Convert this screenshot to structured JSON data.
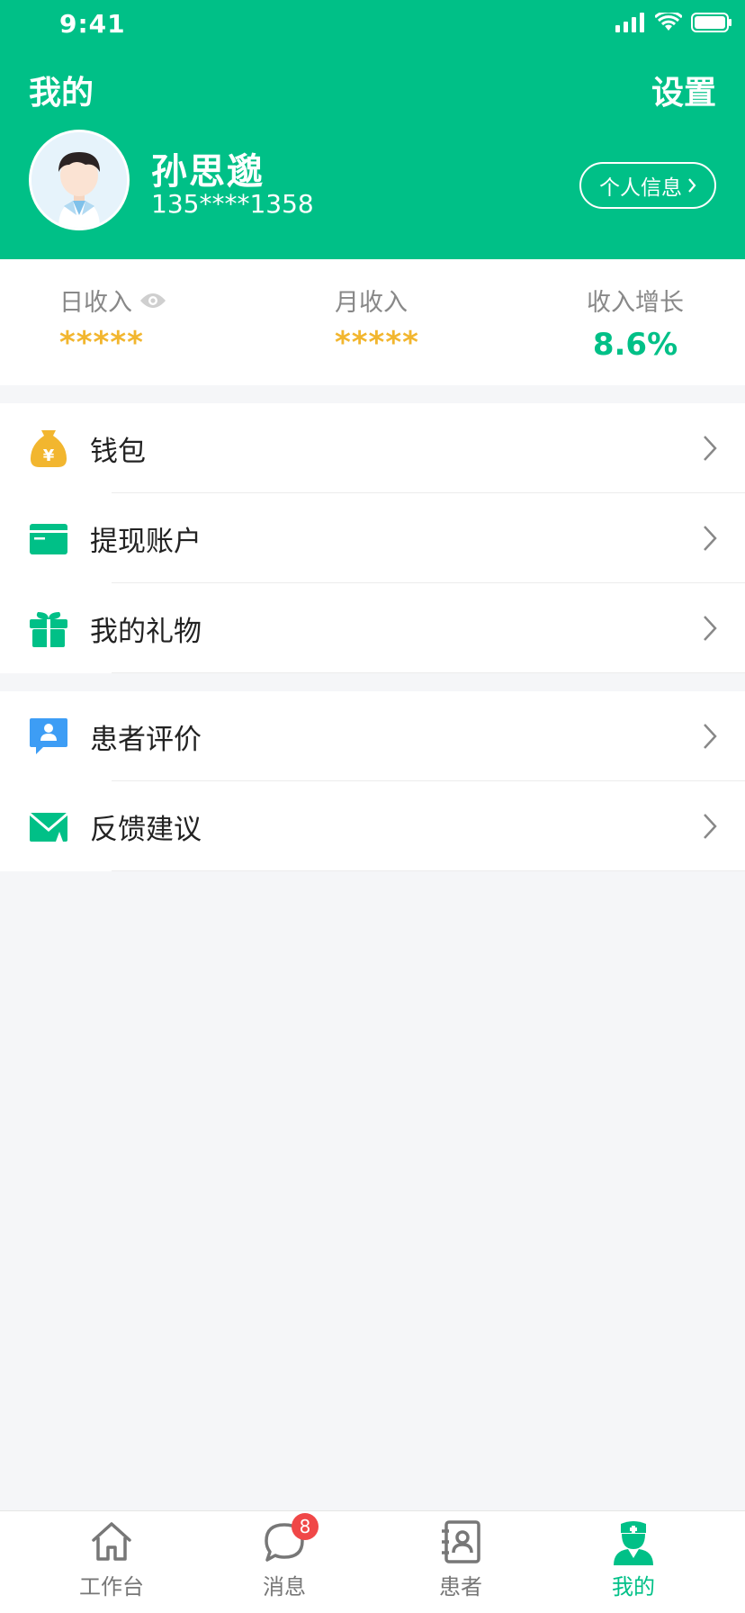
{
  "status_bar": {
    "time": "9:41"
  },
  "header": {
    "title": "我的",
    "settings_label": "设置",
    "user": {
      "name": "孙思邈",
      "phone": "135****1358"
    },
    "profile_button": "个人信息"
  },
  "stats": [
    {
      "label": "日收入",
      "value": "*****"
    },
    {
      "label": "月收入",
      "value": "*****"
    },
    {
      "label": "收入增长",
      "value": "8.6%"
    }
  ],
  "menu_group_1": [
    {
      "label": "钱包",
      "icon": "wallet-bag-icon"
    },
    {
      "label": "提现账户",
      "icon": "card-icon"
    },
    {
      "label": "我的礼物",
      "icon": "gift-icon"
    }
  ],
  "menu_group_2": [
    {
      "label": "患者评价",
      "icon": "review-icon"
    },
    {
      "label": "反馈建议",
      "icon": "mail-icon"
    }
  ],
  "tabbar": [
    {
      "label": "工作台",
      "icon": "home-icon"
    },
    {
      "label": "消息",
      "icon": "chat-icon",
      "badge": "8"
    },
    {
      "label": "患者",
      "icon": "contacts-icon"
    },
    {
      "label": "我的",
      "icon": "doctor-icon",
      "active": true
    }
  ],
  "colors": {
    "primary": "#00c087",
    "stars": "#f2b62f",
    "badge": "#f04747",
    "wallet": "#f2b62f",
    "review": "#3d9df5"
  }
}
